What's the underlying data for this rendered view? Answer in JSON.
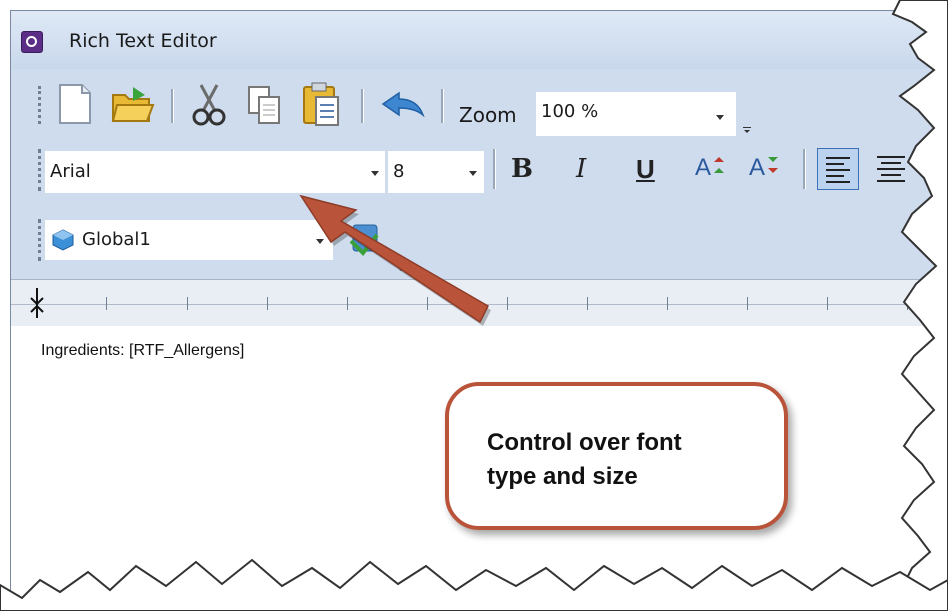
{
  "window": {
    "title": "Rich Text Editor"
  },
  "toolbar_main": {
    "icons": [
      "new-document-icon",
      "open-folder-icon",
      "cut-icon",
      "copy-icon",
      "paste-icon",
      "undo-icon"
    ],
    "zoom_label": "Zoom",
    "zoom_value": "100 %"
  },
  "toolbar_format": {
    "font_name": "Arial",
    "font_size": "8",
    "bold": "B",
    "italic": "I",
    "underline": "U",
    "grow_font": "A",
    "shrink_font": "A"
  },
  "toolbar_fields": {
    "field_name": "Global1"
  },
  "editor": {
    "content": "Ingredients: [RTF_Allergens]"
  },
  "callout": {
    "text_line1": "Control over font",
    "text_line2": "type and size"
  },
  "colors": {
    "accent": "#b9543a",
    "chrome": "#cfdcee",
    "app_icon": "#5b2d86"
  }
}
